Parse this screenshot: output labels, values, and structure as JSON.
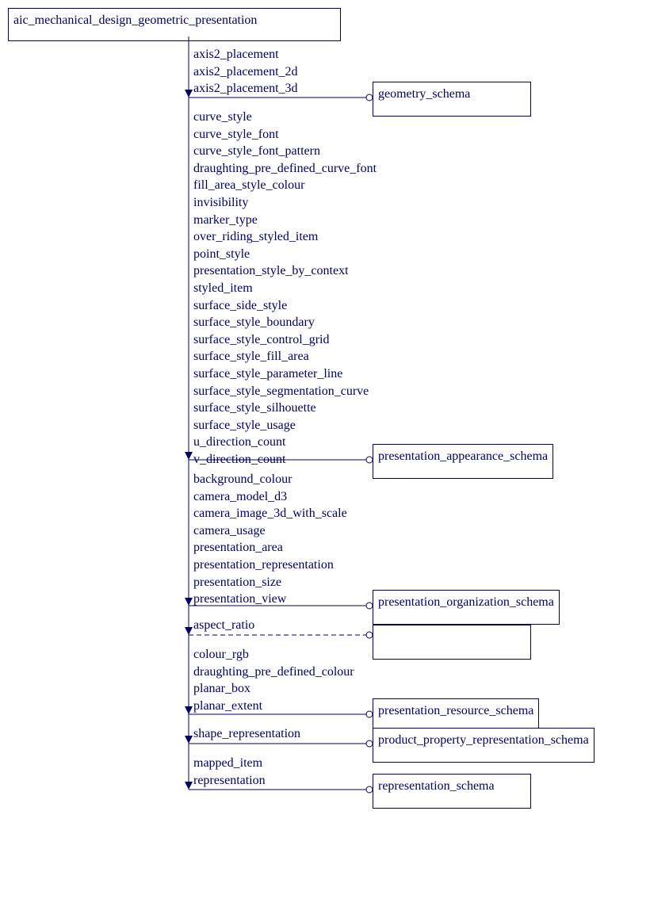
{
  "root": {
    "title": "aic_mechanical_design_geometric_presentation"
  },
  "groups": [
    {
      "target": "geometry_schema",
      "items": [
        "axis2_placement",
        "axis2_placement_2d",
        "axis2_placement_3d"
      ],
      "dashed": false
    },
    {
      "target": "presentation_appearance_schema",
      "items": [
        "curve_style",
        "curve_style_font",
        "curve_style_font_pattern",
        "draughting_pre_defined_curve_font",
        "fill_area_style_colour",
        "invisibility",
        "marker_type",
        "over_riding_styled_item",
        "point_style",
        "presentation_style_by_context",
        "styled_item",
        "surface_side_style",
        "surface_style_boundary",
        "surface_style_control_grid",
        "surface_style_fill_area",
        "surface_style_parameter_line",
        "surface_style_segmentation_curve",
        "surface_style_silhouette",
        "surface_style_usage",
        "u_direction_count",
        "v_direction_count"
      ],
      "dashed": false
    },
    {
      "target": "presentation_organization_schema",
      "items": [
        "background_colour",
        "camera_model_d3",
        "camera_image_3d_with_scale",
        "camera_usage",
        "presentation_area",
        "presentation_representation",
        "presentation_size",
        "presentation_view"
      ],
      "dashed": false
    },
    {
      "target": "",
      "items": [
        "aspect_ratio"
      ],
      "dashed": true
    },
    {
      "target": "presentation_resource_schema",
      "items": [
        "colour_rgb",
        "draughting_pre_defined_colour",
        "planar_box",
        "planar_extent"
      ],
      "dashed": false
    },
    {
      "target": "product_property_representation_schema",
      "items": [
        "shape_representation"
      ],
      "dashed": false
    },
    {
      "target": "representation_schema",
      "items": [
        "mapped_item",
        "representation"
      ],
      "dashed": false
    }
  ]
}
